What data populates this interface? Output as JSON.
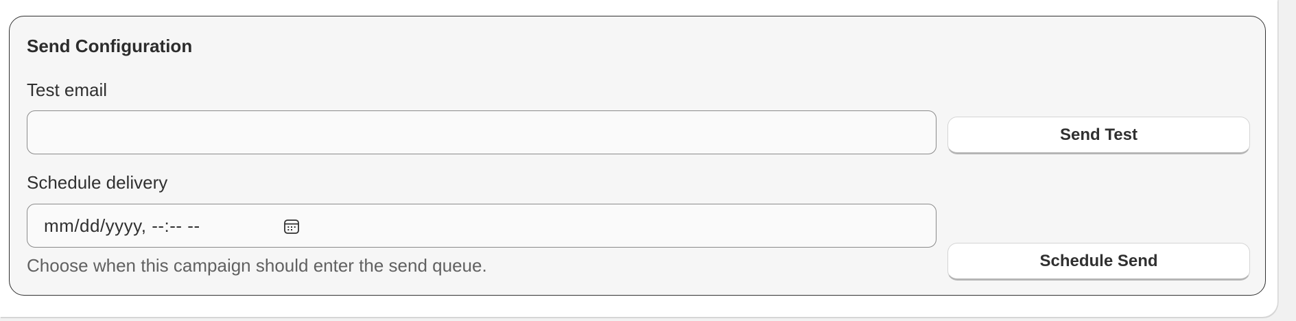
{
  "section": {
    "title": "Send Configuration"
  },
  "test_email": {
    "label": "Test email",
    "value": "",
    "placeholder": "",
    "button_label": "Send Test"
  },
  "schedule": {
    "label": "Schedule delivery",
    "placeholder": "mm/dd/yyyy, --:-- --",
    "help_text": "Choose when this campaign should enter the send queue.",
    "icon": "calendar-icon",
    "button_label": "Schedule Send"
  }
}
